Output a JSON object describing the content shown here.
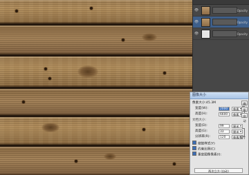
{
  "layers_panel": {
    "layers": [
      {
        "name": "",
        "blend": "Opacity",
        "selected": false,
        "thumb": "wood"
      },
      {
        "name": "",
        "blend": "Opacity",
        "selected": true,
        "thumb": "wood"
      },
      {
        "name": "",
        "blend": "Opacity",
        "selected": false,
        "thumb": "white"
      }
    ]
  },
  "image_size_dialog": {
    "title": "图像大小",
    "pixel_size": "像素大小:45.3M",
    "width_label": "宽度(W):",
    "width_value": "2000",
    "height_label": "高度(H):",
    "height_value": "6600",
    "pixel_unit": "像素",
    "doc_size": "文档大小:",
    "doc_width_label": "宽度(D):",
    "doc_width_value": "99",
    "doc_height_label": "高度(G):",
    "doc_height_value": "33",
    "resolution_label": "分辨率(R):",
    "resolution_value": "120",
    "cm_unit": "厘米",
    "res_unit": "像素/英寸",
    "scale_styles": "缩放样式(Y)",
    "constrain": "约束比例(C)",
    "resample": "重定图像像素(I):",
    "resample_method": "两次立方 (自动)",
    "ok": "确定",
    "cancel": "复位",
    "auto": "自动"
  },
  "colors": {
    "wood_light": "#b08d5c",
    "wood_dark": "#806242",
    "panel_bg": "#474747",
    "selection": "#3e5f8a",
    "dialog_bg": "#e4e4e4"
  }
}
